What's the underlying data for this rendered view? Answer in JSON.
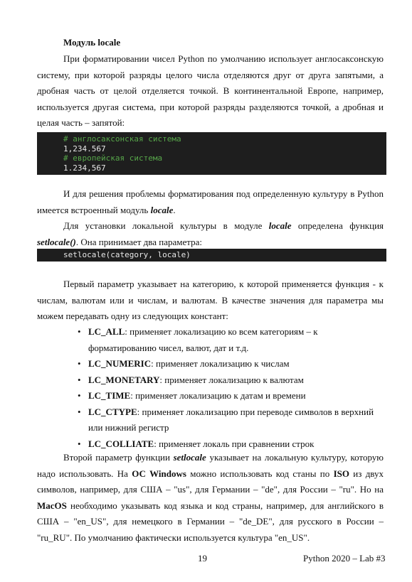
{
  "heading": "Модуль locale",
  "p1": "При форматировании чисел Python по умолчанию использует англосаксонскую систему, при которой разряды целого числа отделяются друг от друга запятыми, а дробная часть от целой отделяется точкой. В континентальной Европе, например, используется другая система, при которой разряды разделяются точкой, а дробная и целая часть – запятой:",
  "code1": {
    "c1": "# англосаксонская система",
    "l1": "1,234.567",
    "c2": "# европейская система",
    "l2": "1.234,567"
  },
  "p2": {
    "text": "И для решения проблемы форматирования под определенную культуру в Python имеется встроенный модуль ",
    "em": "locale",
    "end": "."
  },
  "p3": {
    "a": "Для установки локальной культуры в модуле ",
    "em1": "locale",
    "b": " определена функция ",
    "em2": "setlocale()",
    "c": ". Она принимает два параметра:"
  },
  "code2": "setlocale(category, locale)",
  "p4": "Первый параметр указывает на категорию, к которой применяется функция - к числам, валютам или и числам, и валютам. В качестве значения для параметра мы можем передавать одну из следующих констант:",
  "bullets": [
    {
      "name": "LC_ALL",
      "desc": ": применяет локализацию ко всем категориям – к форматированию чисел, валют, дат и т.д."
    },
    {
      "name": "LC_NUMERIC",
      "desc": ": применяет локализацию к числам"
    },
    {
      "name": "LC_MONETARY",
      "desc": ": применяет локализацию к валютам"
    },
    {
      "name": "LC_TIME",
      "desc": ": применяет локализацию к датам и времени"
    },
    {
      "name": "LC_CTYPE",
      "desc": ": применяет локализацию при переводе символов в верхний или нижний регистр"
    },
    {
      "name": "LC_COLLIATE",
      "desc": ": применяет локаль при сравнении строк"
    }
  ],
  "p5": {
    "a": "Второй параметр функции ",
    "em": "setlocale",
    "b": " указывает на локальную культуру, которую надо использовать. На ",
    "os": "ОС Windows",
    "c": " можно использовать код станы по ",
    "iso": "ISO",
    "d": " из двух символов, например, для США – \"us\", для Германии – \"de\", для России – \"ru\". Но на ",
    "mac": "MacOS",
    "e": " необходимо указывать код языка и код страны, например, для английского в США – \"en_US\", для немецкого в Германии – \"de_DE\", для русского в России – \"ru_RU\". По умолчанию фактически используется культура \"en_US\"."
  },
  "footer": {
    "page": "19",
    "lab": "Python 2020 – Lab #3"
  }
}
